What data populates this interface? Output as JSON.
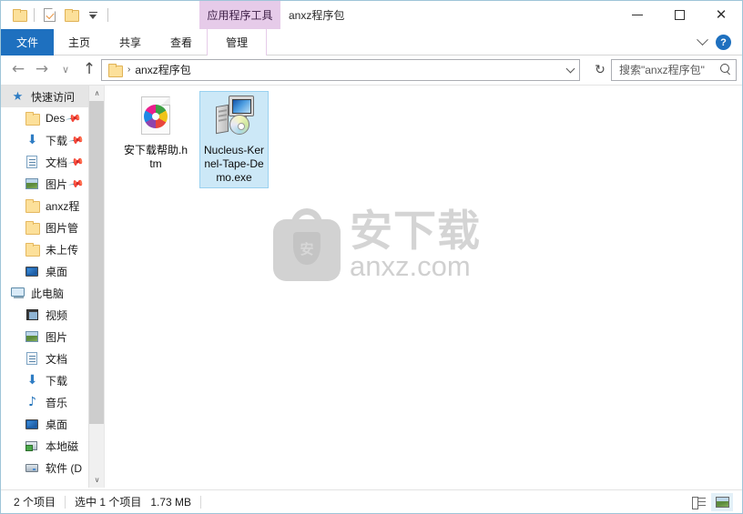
{
  "window": {
    "title": "anxz程序包",
    "contextual_group": "应用程序工具",
    "controls": {
      "minimize": "最小化",
      "maximize": "最大化",
      "close": "关闭"
    }
  },
  "quick_access": {
    "items": [
      {
        "name": "folder-icon",
        "label": "文件夹"
      },
      {
        "name": "properties-icon",
        "label": "属性"
      },
      {
        "name": "new-folder-icon",
        "label": "新建文件夹"
      },
      {
        "name": "customize-dropdown",
        "label": "自定义快速访问工具栏"
      }
    ]
  },
  "ribbon": {
    "tabs": [
      {
        "label": "文件",
        "active": true
      },
      {
        "label": "主页",
        "active": false
      },
      {
        "label": "共享",
        "active": false
      },
      {
        "label": "查看",
        "active": false
      },
      {
        "label": "管理",
        "active": false,
        "contextual": true
      }
    ],
    "collapse_label": "展开功能区",
    "help_label": "?"
  },
  "address_bar": {
    "back": "←",
    "forward": "→",
    "recent": "∨",
    "up": "↑",
    "crumb": "anxz程序包",
    "crumb_separator": "›",
    "dropdown": "∨",
    "refresh": "↻",
    "refresh_label": "刷新"
  },
  "search": {
    "value": "搜索\"anxz程序包\"",
    "icon": "search-icon"
  },
  "sidebar": {
    "groups": [
      {
        "header": {
          "label": "快速访问",
          "icon": "star-pin-icon",
          "selected": true
        },
        "items": [
          {
            "label": "Des",
            "icon": "folder-icon",
            "pinned": true
          },
          {
            "label": "下载",
            "icon": "download-icon",
            "pinned": true
          },
          {
            "label": "文档",
            "icon": "document-icon",
            "pinned": true
          },
          {
            "label": "图片",
            "icon": "pictures-icon",
            "pinned": true
          },
          {
            "label": "anxz程",
            "icon": "folder-icon",
            "pinned": false
          },
          {
            "label": "图片管",
            "icon": "folder-icon",
            "pinned": false
          },
          {
            "label": "未上传",
            "icon": "folder-icon",
            "pinned": false
          },
          {
            "label": "桌面",
            "icon": "desktop-icon",
            "pinned": false
          }
        ]
      },
      {
        "header": {
          "label": "此电脑",
          "icon": "this-pc-icon",
          "selected": false
        },
        "items": [
          {
            "label": "视频",
            "icon": "videos-icon",
            "pinned": false
          },
          {
            "label": "图片",
            "icon": "pictures-icon",
            "pinned": false
          },
          {
            "label": "文档",
            "icon": "document-icon",
            "pinned": false
          },
          {
            "label": "下载",
            "icon": "download-icon",
            "pinned": false
          },
          {
            "label": "音乐",
            "icon": "music-icon",
            "pinned": false
          },
          {
            "label": "桌面",
            "icon": "desktop-icon",
            "pinned": false
          },
          {
            "label": "本地磁",
            "icon": "local-disk-icon",
            "pinned": false
          },
          {
            "label": "软件 (D",
            "icon": "drive-icon",
            "pinned": false
          }
        ]
      }
    ],
    "scroll_up": "∧",
    "scroll_down": "∨"
  },
  "files": [
    {
      "name": "安下载帮助.htm",
      "icon": "html-document-icon",
      "selected": false
    },
    {
      "name": "Nucleus-Kernel-Tape-Demo.exe",
      "icon": "application-setup-icon",
      "selected": true
    }
  ],
  "watermark": {
    "shield_char": "安",
    "cn_text": "安下载",
    "en_text": "anxz.com"
  },
  "status_bar": {
    "item_count": "2 个项目",
    "selection": "选中 1 个项目",
    "size": "1.73 MB",
    "views": [
      {
        "name": "details-view-button",
        "label": "详细信息",
        "active": false
      },
      {
        "name": "large-icons-view-button",
        "label": "大图标",
        "active": true
      }
    ]
  },
  "colors": {
    "accent": "#1e70bf",
    "contextual_tab": "#e6cbe9",
    "selection": "#cce8f7",
    "selection_border": "#99d1f0",
    "folder": "#fce09a",
    "watermark": "#d2d2d2"
  }
}
